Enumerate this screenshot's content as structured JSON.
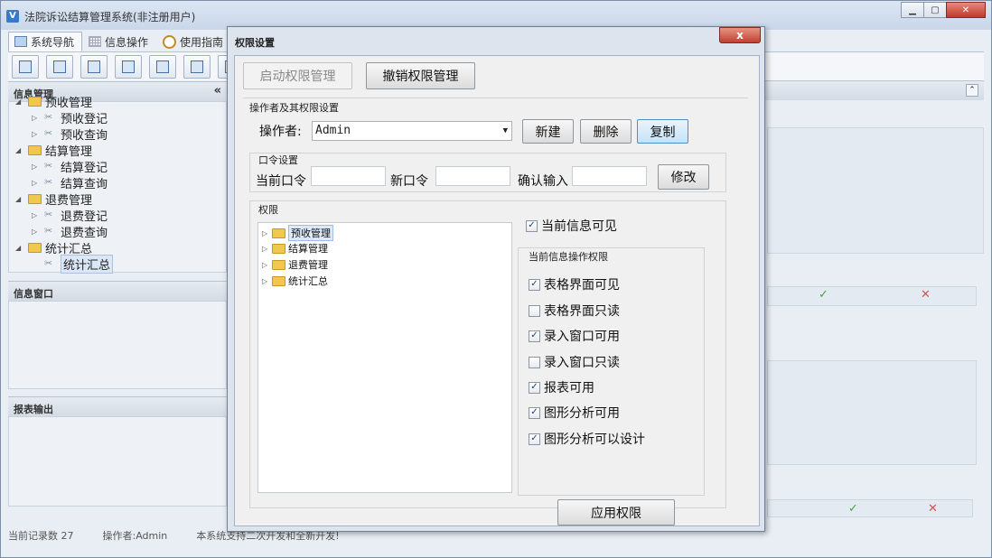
{
  "app": {
    "title": "法院诉讼结算管理系统(非注册用户)",
    "icon_letter": "V"
  },
  "main_tabs": [
    {
      "label": "系统导航"
    },
    {
      "label": "信息操作"
    },
    {
      "label": "使用指南"
    }
  ],
  "left_panel": {
    "info_mgmt_title": "信息管理",
    "collapse_glyph": "«",
    "tree": [
      {
        "label": "预收管理",
        "children": [
          "预收登记",
          "预收查询"
        ]
      },
      {
        "label": "结算管理",
        "children": [
          "结算登记",
          "结算查询"
        ]
      },
      {
        "label": "退费管理",
        "children": [
          "退费登记",
          "退费查询"
        ]
      },
      {
        "label": "统计汇总",
        "children": [
          "统计汇总"
        ]
      }
    ],
    "info_window_title": "信息窗口",
    "report_output_title": "报表输出"
  },
  "right_bg": {
    "collapse_glyph": "⌃",
    "check": "✓",
    "cross": "✕"
  },
  "status_bar": {
    "records": "当前记录数 27",
    "operator": "操作者:Admin",
    "note": "本系统支持二次开发和全新开发!"
  },
  "dialog": {
    "title": "权限设置",
    "close_glyph": "x",
    "enable_button": "启动权限管理",
    "revoke_button": "撤销权限管理",
    "operator_section": "操作者及其权限设置",
    "operator_label": "操作者:",
    "operator_value": "Admin",
    "new_button": "新建",
    "delete_button": "删除",
    "copy_button": "复制",
    "password_section": "口令设置",
    "current_pwd_label": "当前口令",
    "new_pwd_label": "新口令",
    "confirm_label": "确认输入",
    "modify_button": "修改",
    "permission_section": "权限",
    "perm_tree": [
      "预收管理",
      "结算管理",
      "退费管理",
      "统计汇总"
    ],
    "current_visible": {
      "label": "当前信息可见",
      "checked": true
    },
    "ops_section": "当前信息操作权限",
    "ops": [
      {
        "label": "表格界面可见",
        "checked": true
      },
      {
        "label": "表格界面只读",
        "checked": false
      },
      {
        "label": "录入窗口可用",
        "checked": true
      },
      {
        "label": "录入窗口只读",
        "checked": false
      },
      {
        "label": "报表可用",
        "checked": true
      },
      {
        "label": "图形分析可用",
        "checked": true
      },
      {
        "label": "图形分析可以设计",
        "checked": true
      }
    ],
    "apply_button": "应用权限"
  }
}
